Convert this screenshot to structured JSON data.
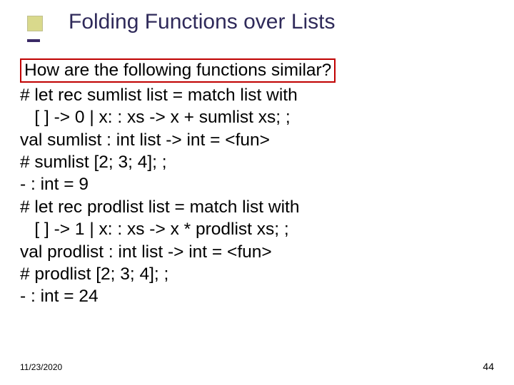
{
  "title": "Folding Functions over Lists",
  "question": "How are the following functions similar?",
  "code_lines": [
    "# let rec sumlist list = match list with",
    "   [ ] -> 0 | x: : xs -> x + sumlist xs; ;",
    "val sumlist : int list -> int = <fun>",
    "# sumlist [2; 3; 4]; ;",
    "- : int = 9",
    "# let rec prodlist list = match list with",
    "   [ ] -> 1 | x: : xs -> x * prodlist xs; ;",
    "val prodlist : int list -> int = <fun>",
    "# prodlist [2; 3; 4]; ;",
    "- : int = 24"
  ],
  "footer": {
    "date": "11/23/2020",
    "page": "44"
  }
}
